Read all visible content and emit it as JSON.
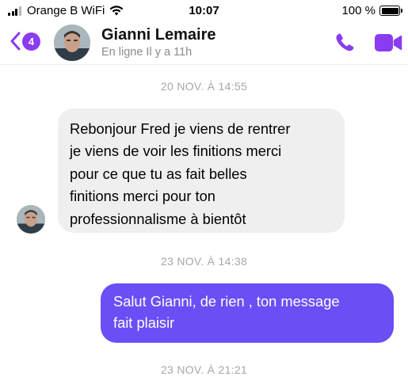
{
  "status_bar": {
    "carrier": "Orange B WiFi",
    "time": "10:07",
    "battery": "100 %"
  },
  "header": {
    "back_badge": "4",
    "contact_name": "Gianni Lemaire",
    "contact_status": "En ligne Il y a 11h",
    "accent_color": "#8b3cf0",
    "icons": [
      "chevron-left-icon",
      "phone-icon",
      "video-camera-icon"
    ]
  },
  "conversation": {
    "items": [
      {
        "kind": "timestamp",
        "text": "20 NOV. À 14:55"
      },
      {
        "kind": "incoming",
        "lines": [
          "Rebonjour Fred je viens de rentrer",
          "je viens de voir les finitions merci",
          "pour ce que tu as fait belles",
          "finitions merci pour ton",
          "professionnalisme à bientôt"
        ]
      },
      {
        "kind": "timestamp",
        "text": "23 NOV. À 14:38"
      },
      {
        "kind": "outgoing",
        "lines": [
          "Salut Gianni, de rien , ton message",
          "fait plaisir"
        ],
        "color": "#6b4ef5"
      },
      {
        "kind": "timestamp",
        "text": "23 NOV. À 21:21"
      }
    ]
  }
}
